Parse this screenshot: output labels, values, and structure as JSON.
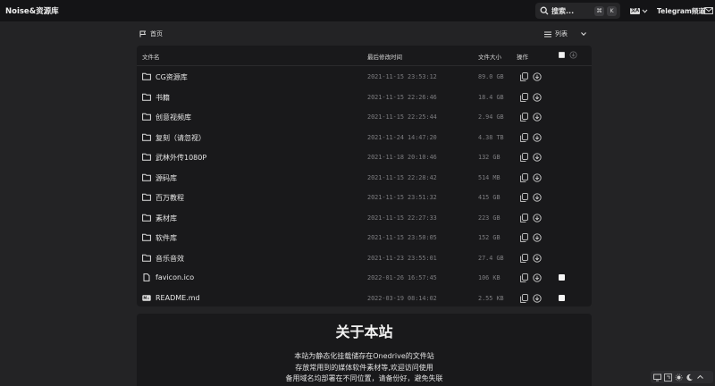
{
  "header": {
    "brand": "Noise&资源库",
    "search_label": "搜索...",
    "search_key_1": "⌘",
    "search_key_2": "K",
    "lang_badge": "文A",
    "telegram": "Telegram频道"
  },
  "toolbar": {
    "breadcrumb": "首页",
    "view_mode": "列表"
  },
  "table": {
    "col_name": "文件名",
    "col_modified": "最后修改时间",
    "col_size": "文件大小",
    "col_actions": "操作",
    "rows": [
      {
        "name": "CG资源库",
        "date": "2021-11-15 23:53:12",
        "size": "89.0 GB",
        "type": "folder"
      },
      {
        "name": "书籍",
        "date": "2021-11-15 22:26:46",
        "size": "18.4 GB",
        "type": "folder"
      },
      {
        "name": "创意视频库",
        "date": "2021-11-15 22:25:44",
        "size": "2.94 GB",
        "type": "folder"
      },
      {
        "name": "复刻（请忽视）",
        "date": "2021-11-24 14:47:20",
        "size": "4.38 TB",
        "type": "folder"
      },
      {
        "name": "武林外传1080P",
        "date": "2021-11-18 20:10:46",
        "size": "132 GB",
        "type": "folder"
      },
      {
        "name": "源码库",
        "date": "2021-11-15 22:28:42",
        "size": "514 MB",
        "type": "folder"
      },
      {
        "name": "百万教程",
        "date": "2021-11-15 23:51:32",
        "size": "415 GB",
        "type": "folder"
      },
      {
        "name": "素材库",
        "date": "2021-11-15 22:27:33",
        "size": "223 GB",
        "type": "folder"
      },
      {
        "name": "软件库",
        "date": "2021-11-15 23:50:05",
        "size": "152 GB",
        "type": "folder"
      },
      {
        "name": "音乐音效",
        "date": "2021-11-23 23:55:01",
        "size": "27.4 GB",
        "type": "folder"
      },
      {
        "name": "favicon.ico",
        "date": "2022-01-26 16:57:45",
        "size": "106 KB",
        "type": "file"
      },
      {
        "name": "README.md",
        "date": "2022-03-19 08:14:02",
        "size": "2.55 KB",
        "type": "markdown"
      }
    ]
  },
  "readme": {
    "title": "关于本站",
    "line1": "本站为静态化挂载储存在Onedrive的文件站",
    "line2": "存放常用到的媒体软件素材等,欢迎访问使用",
    "line3": "备用域名均部署在不同位置，请备份好，避免失联"
  },
  "colors": {
    "background": "#232325",
    "panel": "#19191b",
    "topbar": "#141416"
  }
}
